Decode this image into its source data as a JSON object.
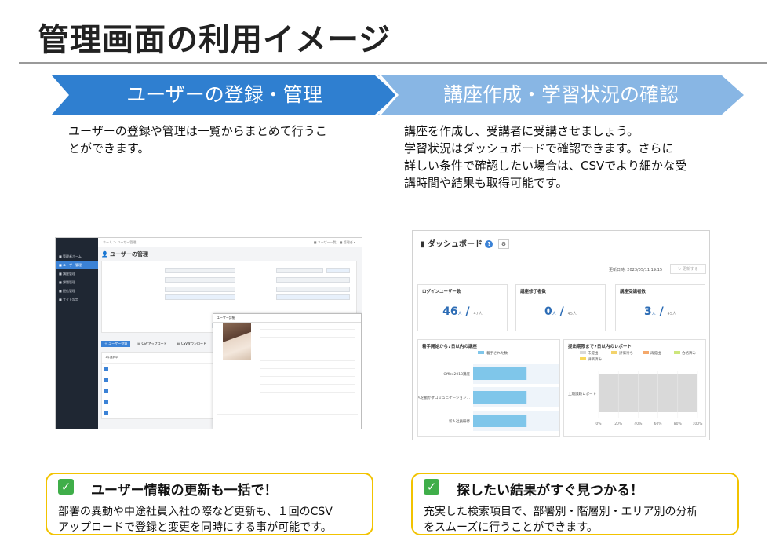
{
  "page": {
    "title": "管理画面の利用イメージ"
  },
  "left": {
    "banner": "ユーザーの登録・管理",
    "description_lines": [
      "ユーザーの登録や管理は一覧からまとめて行うこ",
      "とができます。"
    ],
    "callout_heading": "ユーザー情報の更新も一括で！",
    "callout_body_lines": [
      "部署の異動や中途社員入社の際など更新も、１回のCSV",
      "アップロードで登録と変更を同時にする事が可能です。"
    ]
  },
  "right": {
    "banner": "講座作成・学習状況の確認",
    "description_lines": [
      "講座を作成し、受講者に受講させましょう。",
      "学習状況はダッシュボードで確認できます。さらに",
      "詳しい条件で確認したい場合は、CSVでより細かな受",
      "講時間や結果も取得可能です。"
    ],
    "callout_heading": "探したい結果がすぐ見つかる！",
    "callout_body_lines": [
      "充実した検索項目で、部署別・階層別・エリア別の分析",
      "をスムーズに行うことができます。"
    ]
  },
  "user_admin_screenshot": {
    "heading": "ユーザーの管理",
    "modal_title": "ユーザー詳細",
    "list_label": "1件選択中"
  },
  "dashboard_screenshot": {
    "title": "ダッシュボード",
    "updated": "更新日時: 2023/05/11 19:15",
    "refresh_label": "更新する",
    "kpis": [
      {
        "label": "ログインユーザー数",
        "value": "46",
        "unit": "人",
        "total": "47人"
      },
      {
        "label": "講座修了者数",
        "value": "0",
        "unit": "人",
        "total": "45人"
      },
      {
        "label": "講座受講者数",
        "value": "3",
        "unit": "人",
        "total": "45人"
      }
    ],
    "recent_courses_title": "着手開始から7日以内の講座",
    "recent_courses_legend": "着手された数",
    "recent_courses": [
      "Office2013講座",
      "人を動かすコミュニケーション研修～行動経済学を活用して～",
      "新人社員研修"
    ],
    "recent_courses_bars": [
      0.62,
      0.62,
      0.62
    ],
    "reports_title": "提出期限まで7日以内のレポート",
    "reports_legend": [
      "未提出",
      "評価待ち",
      "再提出",
      "合格済み",
      "評価済み"
    ],
    "reports_legend_colors": [
      "#d9d9d9",
      "#f3d36b",
      "#f4a86b",
      "#cde67c",
      "#f8d85c"
    ],
    "reports_row": "上期課題レポート",
    "reports_ticks": [
      "0%",
      "20%",
      "40%",
      "60%",
      "80%",
      "100%"
    ]
  },
  "colors": {
    "banner_left": "#2f7fd0",
    "banner_right": "#88b6e4",
    "callout_border": "#f2c300",
    "check_green": "#3fae49"
  }
}
